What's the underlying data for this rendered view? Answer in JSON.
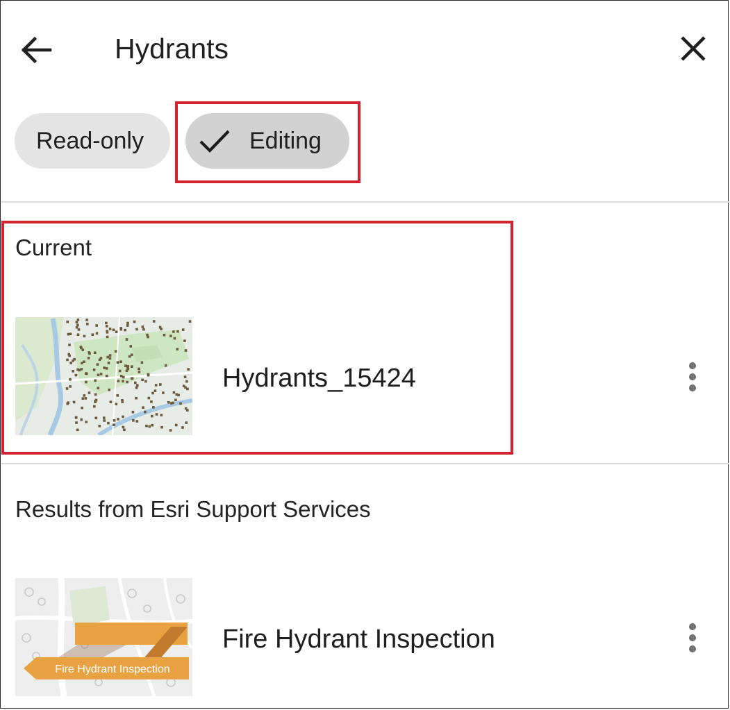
{
  "header": {
    "title": "Hydrants",
    "back_icon": "arrow-left-icon",
    "close_icon": "close-icon"
  },
  "filters": {
    "readonly_label": "Read-only",
    "editing_label": "Editing",
    "selected": "Editing",
    "check_icon": "check-icon"
  },
  "sections": {
    "current": {
      "label": "Current",
      "item": {
        "title": "Hydrants_15424",
        "more_icon": "more-vertical-icon"
      }
    },
    "results": {
      "label": "Results from Esri Support Services",
      "item": {
        "title": "Fire Hydrant Inspection",
        "thumbnail_banner": "Fire Hydrant Inspection",
        "more_icon": "more-vertical-icon"
      }
    }
  },
  "colors": {
    "highlight": "#d42330",
    "chip_readonly_bg": "#e5e5e5",
    "chip_selected_bg": "#d2d2d2",
    "banner_orange": "#e9a241"
  }
}
